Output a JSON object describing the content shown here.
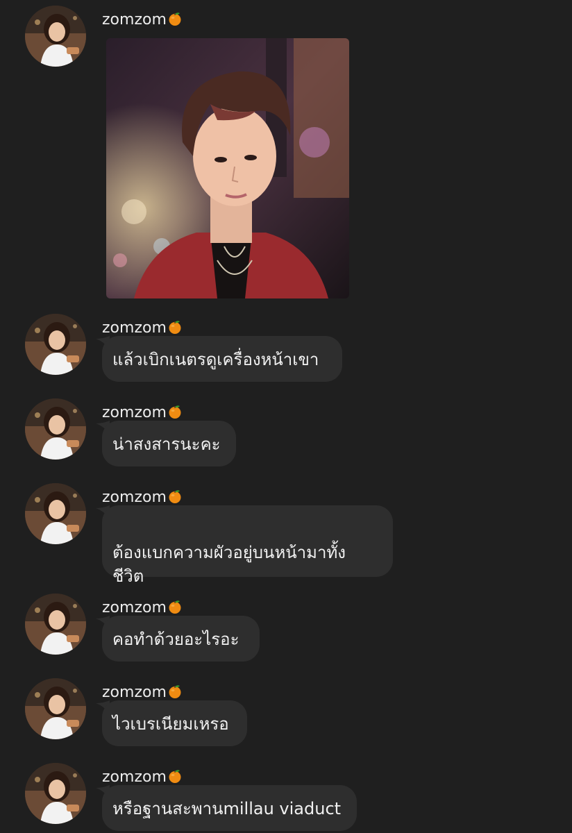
{
  "chat": {
    "sender_name": "zomzom",
    "sender_emoji_icon": "tangerine-icon",
    "messages": [
      {
        "type": "image",
        "alt_desc": "photo"
      },
      {
        "type": "text",
        "text": "แล้วเบิกเนตรดูเครื่องหน้าเขา"
      },
      {
        "type": "text",
        "text": "น่าสงสารนะคะ"
      },
      {
        "type": "text",
        "text": "ต้องแบกความผัวอยู่บนหน้ามาทั้ง\nชีวิต"
      },
      {
        "type": "text",
        "text": "คอทำด้วยอะไรอะ"
      },
      {
        "type": "text",
        "text": "ไวเบรเนียมเหรอ"
      },
      {
        "type": "text",
        "text": "หรือฐานสะพานmillau viaduct"
      }
    ]
  },
  "colors": {
    "background": "#1f1f1f",
    "bubble": "#2e2e2e",
    "text": "#f1f1f1",
    "orange": "#f08c12"
  }
}
